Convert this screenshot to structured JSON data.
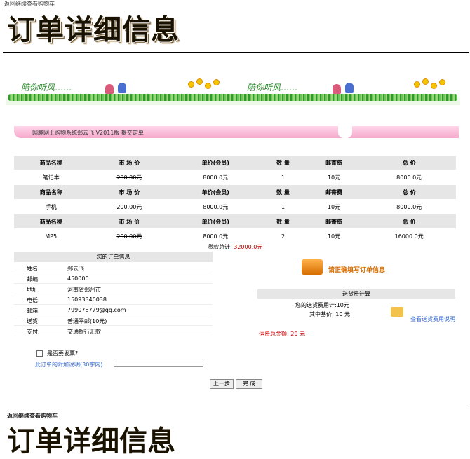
{
  "top_link": "返回继续查看购物车",
  "page_title": "订单详细信息",
  "banner": {
    "text": "陪你听风……"
  },
  "breadcrumb": "网趣网上购物系统郑云飞 V2011版 提交定单",
  "items_header": [
    "商品名称",
    "市 场 价",
    "单价(会员)",
    "数 量",
    "邮寄费",
    "总 价"
  ],
  "items": [
    {
      "name": "笔记本",
      "market": "200.00元",
      "price": "8000.0元",
      "qty": "1",
      "post": "10元",
      "total": "8000.0元"
    },
    {
      "name": "手机",
      "market": "200.00元",
      "price": "8000.0元",
      "qty": "1",
      "post": "10元",
      "total": "8000.0元"
    },
    {
      "name": "MP5",
      "market": "200.00元",
      "price": "8000.0元",
      "qty": "2",
      "post": "10元",
      "total": "16000.0元"
    }
  ],
  "total": {
    "label": "货款总计:",
    "value": "32000.0元"
  },
  "order_info": {
    "header": "您的订单信息",
    "rows": [
      {
        "k": "姓名:",
        "v": "郑云飞"
      },
      {
        "k": "邮编:",
        "v": "450000"
      },
      {
        "k": "地址:",
        "v": "河南省郑州市"
      },
      {
        "k": "电话:",
        "v": "15093340038"
      },
      {
        "k": "邮箱:",
        "v": "799078779@qq.com"
      },
      {
        "k": "送货:",
        "v": "普通平邮(10元)"
      },
      {
        "k": "支付:",
        "v": "交通银行汇款"
      }
    ]
  },
  "order_prompt": "请正确填写订单信息",
  "fee": {
    "header": "送货费计算",
    "line1": "您的送货费用计:10元",
    "line2": "其中基价: 10 元",
    "link": "查看送货费用说明",
    "grand": "运费总金额: 20 元"
  },
  "invoice_label": "是否要发票?",
  "note_label": "此订单的附加说明(30字内)",
  "btn_prev": "上一步",
  "btn_done": "完 成",
  "bottom_link": "返回继续查看购物车",
  "bottom_title": "订单详细信息"
}
